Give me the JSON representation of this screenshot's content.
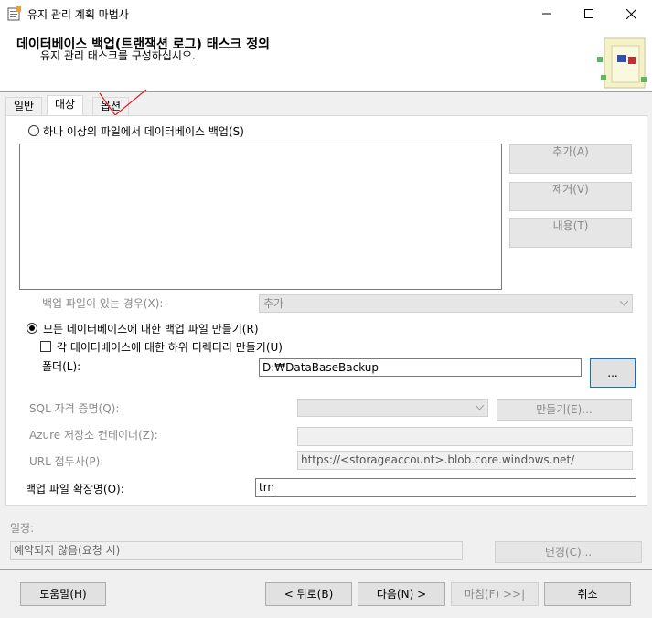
{
  "window": {
    "title": "유지 관리 계획 마법사"
  },
  "header": {
    "title": "데이터베이스 백업(트랜잭션 로그) 태스크 정의",
    "subtitle": "유지 관리 태스크를 구성하십시오."
  },
  "tabs": [
    "일반",
    "대상",
    "옵션"
  ],
  "target": {
    "option_files_label": "하나 이상의 파일에서 데이터베이스 백업(S)",
    "buttons": {
      "add": "추가(A)",
      "remove": "제거(V)",
      "contents": "내용(T)"
    },
    "if_exists_label": "백업 파일이 있는 경우(X):",
    "if_exists_value": "추가",
    "option_each_db_label": "모든 데이터베이스에 대한 백업 파일 만들기(R)",
    "subdir_label": "각 데이터베이스에 대한 하위 디렉터리 만들기(U)",
    "folder_label": "폴더(L):",
    "folder_value": "D:₩DataBaseBackup",
    "browse_label": "...",
    "sql_credential_label": "SQL 자격 증명(Q):",
    "create_label": "만들기(E)...",
    "azure_container_label": "Azure 저장소 컨테이너(Z):",
    "url_prefix_label": "URL 접두사(P):",
    "url_prefix_value": "https://<storageaccount>.blob.core.windows.net/",
    "extension_label": "백업 파일 확장명(O):",
    "extension_value": "trn"
  },
  "schedule": {
    "label": "일정:",
    "value": "예약되지 않음(요청 시)",
    "change_label": "변경(C)..."
  },
  "footer": {
    "help": "도움말(H)",
    "back": "< 뒤로(B)",
    "next": "다음(N) >",
    "finish": "마침(F) >>|",
    "cancel": "취소"
  }
}
